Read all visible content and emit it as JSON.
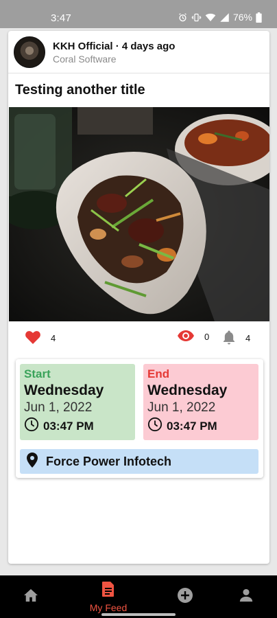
{
  "status_bar": {
    "time": "3:47",
    "battery": "76%",
    "icons": [
      "alarm-icon",
      "vibrate-icon",
      "wifi-icon",
      "signal-icon",
      "battery-icon"
    ]
  },
  "post": {
    "author": "KKH Official",
    "separator": "·",
    "posted": "4 days ago",
    "organization": "Coral Software",
    "title": "Testing another title",
    "image_alt": "Plate of stir-fried food"
  },
  "stats": {
    "likes": "4",
    "views": "0",
    "notifications": "4"
  },
  "event": {
    "start": {
      "label": "Start",
      "day": "Wednesday",
      "date": "Jun 1, 2022",
      "time": "03:47 PM"
    },
    "end": {
      "label": "End",
      "day": "Wednesday",
      "date": "Jun 1, 2022",
      "time": "03:47 PM"
    },
    "location": "Force Power Infotech"
  },
  "bottom_nav": {
    "items": [
      {
        "icon": "home-icon",
        "label": ""
      },
      {
        "icon": "feed-icon",
        "label": "My Feed"
      },
      {
        "icon": "add-circle-icon",
        "label": ""
      },
      {
        "icon": "profile-icon",
        "label": ""
      }
    ],
    "active_index": 1
  },
  "colors": {
    "accent": "#f05442",
    "start_bg": "#c9e5c8",
    "end_bg": "#fccbd3",
    "location_bg": "#c5dff7"
  }
}
